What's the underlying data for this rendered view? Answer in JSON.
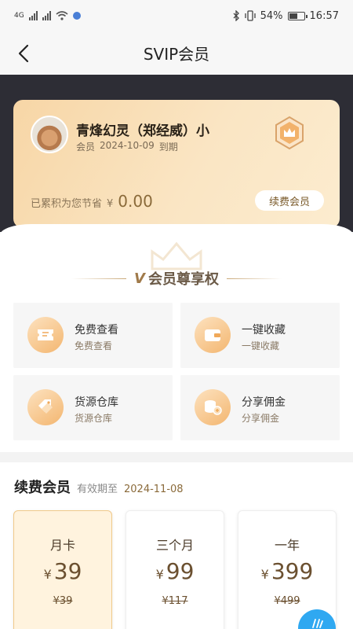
{
  "status_bar": {
    "network": "4G",
    "battery": "54%",
    "time": "16:57"
  },
  "nav": {
    "title": "SVIP会员"
  },
  "member_card": {
    "name": "青烽幻灵（郑经威）小",
    "role": "会员",
    "expiry_date": "2024-10-09",
    "expiry_suffix": "到期",
    "savings_label": "已累积为您节省",
    "savings_currency": "¥",
    "savings_value": "0.00",
    "renew_button": "续费会员"
  },
  "privileges": {
    "title": "会员尊享权",
    "items": [
      {
        "title": "免费查看",
        "subtitle": "免费查看",
        "icon": "ticket-icon"
      },
      {
        "title": "一键收藏",
        "subtitle": "一键收藏",
        "icon": "wallet-icon"
      },
      {
        "title": "货源仓库",
        "subtitle": "货源仓库",
        "icon": "tags-icon"
      },
      {
        "title": "分享佣金",
        "subtitle": "分享佣金",
        "icon": "coins-icon"
      }
    ]
  },
  "renew": {
    "title": "续费会员",
    "valid_label": "有效期至",
    "valid_date": "2024-11-08",
    "plans": [
      {
        "name": "月卡",
        "currency": "¥",
        "price": "39",
        "original": "¥39",
        "selected": true
      },
      {
        "name": "三个月",
        "currency": "¥",
        "price": "99",
        "original": "¥117",
        "selected": false
      },
      {
        "name": "一年",
        "currency": "¥",
        "price": "399",
        "original": "¥499",
        "selected": false
      }
    ]
  },
  "colors": {
    "accent": "#8a6a3a",
    "card_gold": "#f7d6a6",
    "dark_band": "#2d2d35",
    "fab": "#2fa8f1"
  }
}
